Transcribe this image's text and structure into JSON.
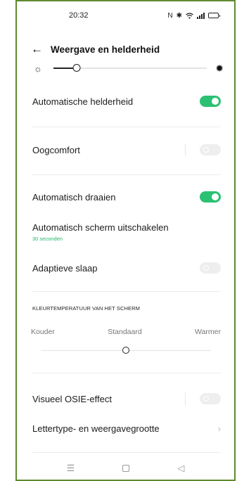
{
  "status": {
    "time": "20:32",
    "icons": [
      "nfc-icon",
      "bluetooth-icon",
      "wifi-icon",
      "signal-icon",
      "battery-icon"
    ]
  },
  "header": {
    "title": "Weergave en helderheid"
  },
  "brightness": {
    "level": 0.15
  },
  "settings": {
    "auto_brightness": {
      "label": "Automatische helderheid",
      "enabled": true
    },
    "eye_comfort": {
      "label": "Oogcomfort",
      "enabled": false
    },
    "auto_rotate": {
      "label": "Automatisch draaien",
      "enabled": true
    },
    "screen_timeout": {
      "label": "Automatisch scherm uitschakelen",
      "value": "30 seconden"
    },
    "adaptive_sleep": {
      "label": "Adaptieve slaap",
      "enabled": false
    }
  },
  "color_temperature": {
    "section_title": "KLEURTEMPERATUUR VAN HET SCHERM",
    "cooler": "Kouder",
    "standard": "Standaard",
    "warmer": "Warmer",
    "level": 0.5
  },
  "more_settings": {
    "osie": {
      "label": "Visueel OSIE-effect",
      "enabled": false
    },
    "font_size": {
      "label": "Lettertype- en weergavegrootte"
    }
  },
  "colors": {
    "accent": "#2bc073",
    "frame": "#5f8a2e"
  }
}
